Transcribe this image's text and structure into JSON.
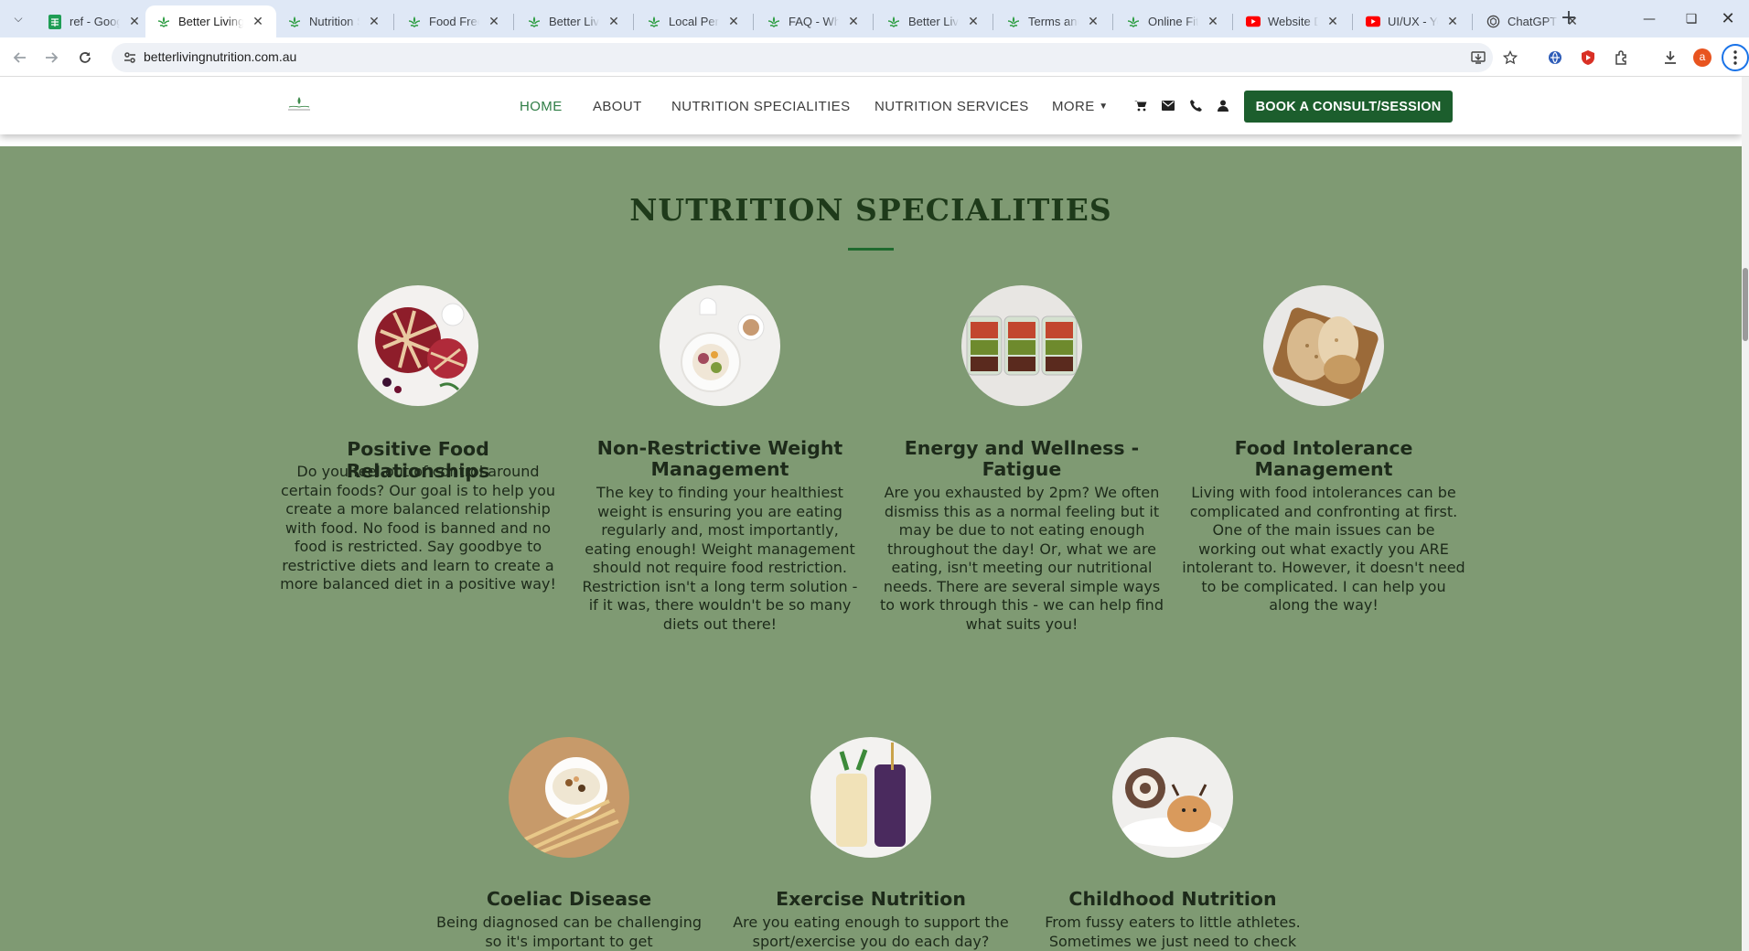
{
  "browser": {
    "tabs": [
      {
        "title": "ref - Google Sheets",
        "favicon": "sheets-icon",
        "active": false
      },
      {
        "title": "Better Living Nutrition",
        "favicon": "leaf-icon",
        "active": true
      },
      {
        "title": "Nutrition Specialities",
        "favicon": "leaf-icon",
        "active": false
      },
      {
        "title": "Food Freedom",
        "favicon": "leaf-icon",
        "active": false
      },
      {
        "title": "Better Living Nutrition",
        "favicon": "leaf-icon",
        "active": false
      },
      {
        "title": "Local Personal",
        "favicon": "leaf-icon",
        "active": false
      },
      {
        "title": "FAQ - What",
        "favicon": "leaf-icon",
        "active": false
      },
      {
        "title": "Better Living",
        "favicon": "leaf-icon",
        "active": false
      },
      {
        "title": "Terms and",
        "favicon": "leaf-icon",
        "active": false
      },
      {
        "title": "Online Fitness",
        "favicon": "leaf-icon",
        "active": false
      },
      {
        "title": "Website Design",
        "favicon": "youtube-icon",
        "active": false
      },
      {
        "title": "UI/UX - YouTube",
        "favicon": "youtube-icon",
        "active": false
      },
      {
        "title": "ChatGPT",
        "favicon": "chatgpt-icon",
        "active": false
      }
    ],
    "url": "betterlivingnutrition.com.au",
    "profile_initial": "a",
    "colors": {
      "tabbar": "#dfe8f6",
      "accent_green": "#1c5e2d"
    }
  },
  "site": {
    "nav": {
      "home": "HOME",
      "about": "ABOUT",
      "specialities": "NUTRITION SPECIALITIES",
      "services": "NUTRITION SERVICES",
      "more": "MORE",
      "cta": "BOOK A CONSULT/SESSION"
    },
    "header_icons": [
      "cart-icon",
      "envelope-icon",
      "phone-icon",
      "user-icon"
    ],
    "section_title": "NUTRITION SPECIALITIES",
    "cards": [
      {
        "title": "Positive Food Relationships",
        "image": "berry-pies-photo",
        "text": "Do you feel out of control around certain foods? Our goal is to help you create a more balanced relationship with food. No food is banned and no food is restricted. Say goodbye to restrictive diets and learn to create a more balanced diet in a positive way!"
      },
      {
        "title": "Non-Restrictive Weight Management",
        "image": "breakfast-bowl-photo",
        "text": "The key to finding your healthiest weight is ensuring you are eating regularly and, most importantly, eating enough! Weight management should not require food restriction. Restriction isn't a long term solution - if it was, there wouldn't be so many diets out there!"
      },
      {
        "title": "Energy and Wellness - Fatigue",
        "image": "meal-prep-containers-photo",
        "text": "Are you exhausted by 2pm? We often dismiss this as a normal feeling but it may be due to not eating enough throughout the day! Or, what we are eating, isn't meeting our nutritional needs. There are several simple ways to work through this - we can help find what suits you!"
      },
      {
        "title": "Food Intolerance Management",
        "image": "bread-board-photo",
        "text": "Living with food intolerances can be complicated and confronting at first. One of the main issues can be working out what exactly you ARE intolerant to. However, it doesn't need to be complicated. I can help you along the way!"
      },
      {
        "title": "Coeliac Disease",
        "image": "cereal-wheat-photo",
        "text": "Being diagnosed can be challenging so it's important to get"
      },
      {
        "title": "Exercise Nutrition",
        "image": "smoothies-photo",
        "text": "Are you eating enough to support the sport/exercise you do each day?"
      },
      {
        "title": "Childhood Nutrition",
        "image": "kids-desserts-photo",
        "text": "From fussy eaters to little athletes. Sometimes we just need to check"
      }
    ]
  }
}
